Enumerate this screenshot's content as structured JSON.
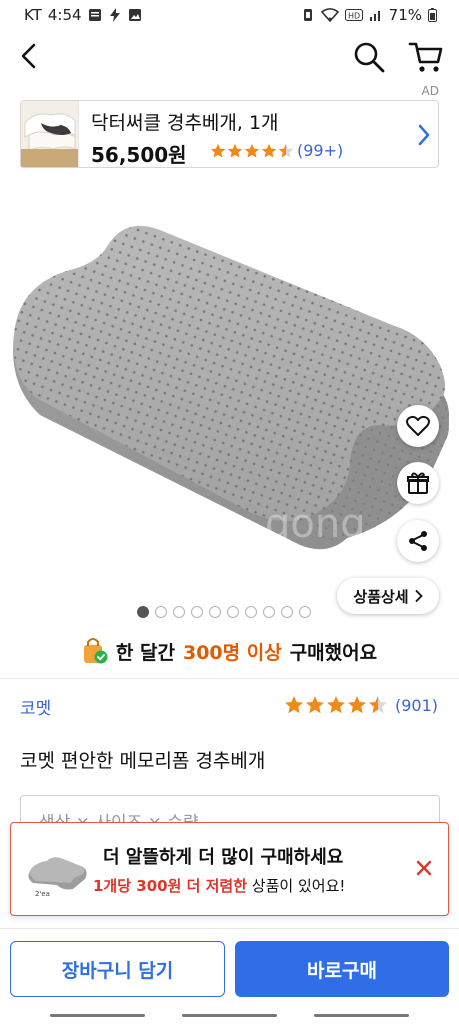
{
  "status_bar": {
    "carrier": "KT",
    "time": "4:54",
    "battery": "71%"
  },
  "ad": {
    "label": "AD",
    "title": "닥터써클 경추베개, 1개",
    "price": "56,500원",
    "rating": 4.5,
    "review_count": "(99+)"
  },
  "product": {
    "image_count": 10,
    "active_image": 1,
    "detail_button": "상품상세",
    "purchase_info": {
      "prefix": "한 달간",
      "highlight": "300명 이상",
      "suffix": "구매했어요"
    },
    "brand": "코멧",
    "rating": 4.5,
    "review_count": "(901)",
    "name": "코멧 편안한 메모리폼 경추베개",
    "option_placeholder": "색상 × 사이즈 × 수량"
  },
  "promo": {
    "title": "더 알뜰하게 더 많이 구매하세요",
    "highlight": "1개당 300원 더 저렴한",
    "suffix": "상품이 있어요!",
    "thumb_caption": "2'ea"
  },
  "bottom": {
    "add_to_cart": "장바구니 담기",
    "buy_now": "바로구매"
  },
  "colors": {
    "accent_blue": "#2f6ee6",
    "link_blue": "#3a66d1",
    "star_orange": "#f08a17",
    "highlight_orange": "#e35b00",
    "alert_red": "#e0352b"
  }
}
